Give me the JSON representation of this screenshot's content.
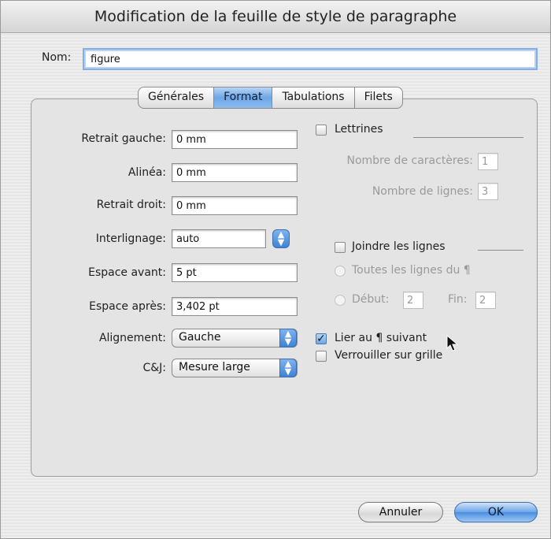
{
  "window": {
    "title": "Modification de la feuille de style de paragraphe"
  },
  "name": {
    "label": "Nom:",
    "value": "figure"
  },
  "tabs": [
    {
      "label": "Générales",
      "active": false
    },
    {
      "label": "Format",
      "active": true
    },
    {
      "label": "Tabulations",
      "active": false
    },
    {
      "label": "Filets",
      "active": false
    }
  ],
  "format": {
    "left_indent": {
      "label": "Retrait gauche:",
      "value": "0 mm"
    },
    "first_line": {
      "label": "Alinéa:",
      "value": "0 mm"
    },
    "right_indent": {
      "label": "Retrait droit:",
      "value": "0 mm"
    },
    "leading": {
      "label": "Interlignage:",
      "value": "auto"
    },
    "space_before": {
      "label": "Espace avant:",
      "value": "5 pt"
    },
    "space_after": {
      "label": "Espace après:",
      "value": "3,402 pt"
    },
    "alignment": {
      "label": "Alignement:",
      "value": "Gauche"
    },
    "hj": {
      "label": "C&J:",
      "value": "Mesure large"
    }
  },
  "drop_caps": {
    "label": "Lettrines",
    "checked": false,
    "char_count_label": "Nombre de caractères:",
    "char_count_value": "1",
    "line_count_label": "Nombre de lignes:",
    "line_count_value": "3"
  },
  "keep_lines": {
    "label": "Joindre les lignes",
    "checked": false,
    "all_lines_label": "Toutes les lignes du ¶",
    "start_label": "Début:",
    "start_value": "2",
    "end_label": "Fin:",
    "end_value": "2"
  },
  "keep_with_next": {
    "label": "Lier au ¶ suivant",
    "checked": true
  },
  "lock_to_grid": {
    "label": "Verrouiller sur grille",
    "checked": false
  },
  "buttons": {
    "cancel": "Annuler",
    "ok": "OK"
  },
  "colors": {
    "accent": "#5a98e4",
    "panel": "#e4e4e4"
  }
}
